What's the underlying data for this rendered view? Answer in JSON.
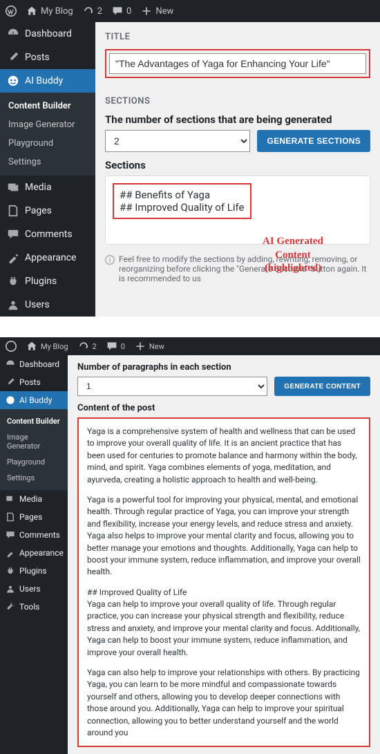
{
  "adminbar": {
    "site": "My Blog",
    "updates": "2",
    "comments": "0",
    "new": "New"
  },
  "sidebar": {
    "dashboard": "Dashboard",
    "posts": "Posts",
    "ai_buddy": "AI Buddy",
    "submenu": {
      "content_builder": "Content Builder",
      "image_generator": "Image Generator",
      "playground": "Playground",
      "settings": "Settings"
    },
    "media": "Media",
    "pages": "Pages",
    "comments": "Comments",
    "appearance": "Appearance",
    "plugins": "Plugins",
    "users": "Users",
    "tools": "Tools"
  },
  "panel1": {
    "title_heading": "TITLE",
    "title_value": "\"The Advantages of Yaga for Enhancing Your Life\"",
    "sections_heading": "SECTIONS",
    "num_sections_label": "The number of sections that are being generated",
    "num_sections_value": "2",
    "generate_sections_btn": "GENERATE SECTIONS",
    "sections_label": "Sections",
    "section_line1": "## Benefits of Yaga",
    "section_line2": "## Improved Quality of Life",
    "helper_text": "Feel free to modify the sections by adding, rewriting, removing, or reorganizing before clicking the \"Generate Sections\" button again. It is recommended to us"
  },
  "annotation": {
    "l1": "AI Generated",
    "l2": "Content",
    "l3": "(highlighted)"
  },
  "panel2": {
    "num_para_label": "Number of paragraphs in each section",
    "num_para_value": "1",
    "generate_content_btn": "GENERATE CONTENT",
    "content_label": "Content of the post",
    "p1": "Yaga is a comprehensive system of health and wellness that can be used to improve your overall quality of life. It is an ancient practice that has been used for centuries to promote balance and harmony within the body, mind, and spirit. Yaga combines elements of yoga, meditation, and ayurveda, creating a holistic approach to health and well-being.",
    "p2": "Yaga is a powerful tool for improving your physical, mental, and emotional health. Through regular practice of Yaga, you can improve your strength and flexibility, increase your energy levels, and reduce stress and anxiety. Yaga also helps to improve your mental clarity and focus, allowing you to better manage your emotions and thoughts. Additionally, Yaga can help to boost your immune system, reduce inflammation, and improve your overall health.",
    "p3": "## Improved Quality of Life\nYaga can help to improve your overall quality of life. Through regular practice, you can increase your physical strength and flexibility, reduce stress and anxiety, and improve your mental clarity and focus. Additionally, Yaga can help to boost your immune system, reduce inflammation, and improve your overall health.",
    "p4": "Yaga can also help to improve your relationships with others. By practicing Yaga, you can learn to be more mindful and compassionate towards yourself and others, allowing you to develop deeper connections with those around you. Additionally, Yaga can help to improve your spiritual connection, allowing you to better understand yourself and the world around you"
  }
}
